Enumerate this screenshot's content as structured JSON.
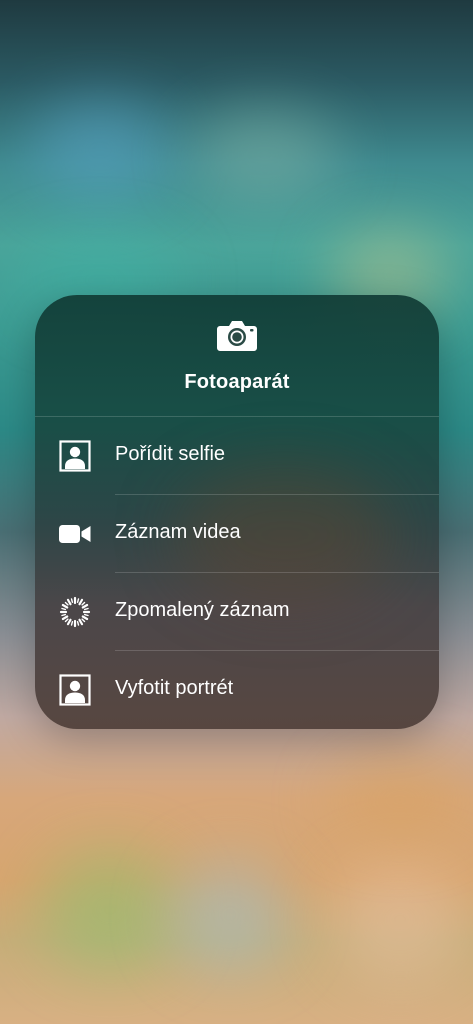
{
  "menu": {
    "app_icon": "camera-icon",
    "title": "Fotoaparát",
    "items": [
      {
        "label": "Pořídit selfie",
        "icon": "selfie-portrait-icon"
      },
      {
        "label": "Záznam videa",
        "icon": "video-camera-icon"
      },
      {
        "label": "Zpomalený záznam",
        "icon": "slow-motion-icon"
      },
      {
        "label": "Vyfotit portrét",
        "icon": "portrait-icon"
      }
    ]
  },
  "colors": {
    "text": "#ffffff",
    "card_top": "#103a34",
    "card_bottom": "#4e3e38"
  }
}
